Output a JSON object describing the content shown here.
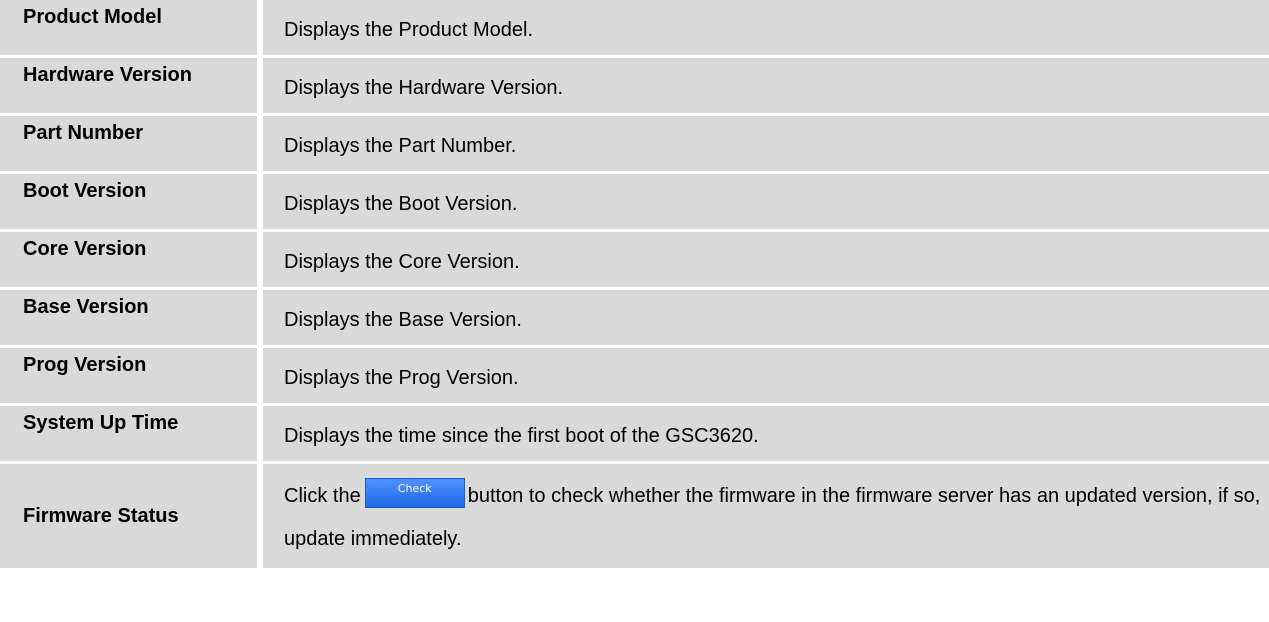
{
  "rows": [
    {
      "label": "Product Model",
      "description": "Displays the Product Model."
    },
    {
      "label": "Hardware Version",
      "description": "Displays the Hardware Version."
    },
    {
      "label": "Part Number",
      "description": "Displays the Part Number."
    },
    {
      "label": "Boot Version",
      "description": "Displays the Boot Version."
    },
    {
      "label": "Core Version",
      "description": "Displays the Core Version."
    },
    {
      "label": "Base Version",
      "description": "Displays the Base Version."
    },
    {
      "label": "Prog Version",
      "description": "Displays the Prog Version."
    },
    {
      "label": "System Up Time",
      "description": "Displays the time since the first boot of the GSC3620."
    }
  ],
  "firmware": {
    "label": "Firmware Status",
    "text_before": "Click the",
    "button_label": "Check",
    "text_after": "button to check whether the firmware in the firmware server has an updated version, if so, update immediately."
  },
  "colors": {
    "cell_background": "#d9d9d9",
    "button_blue": "#2f7bf5"
  }
}
